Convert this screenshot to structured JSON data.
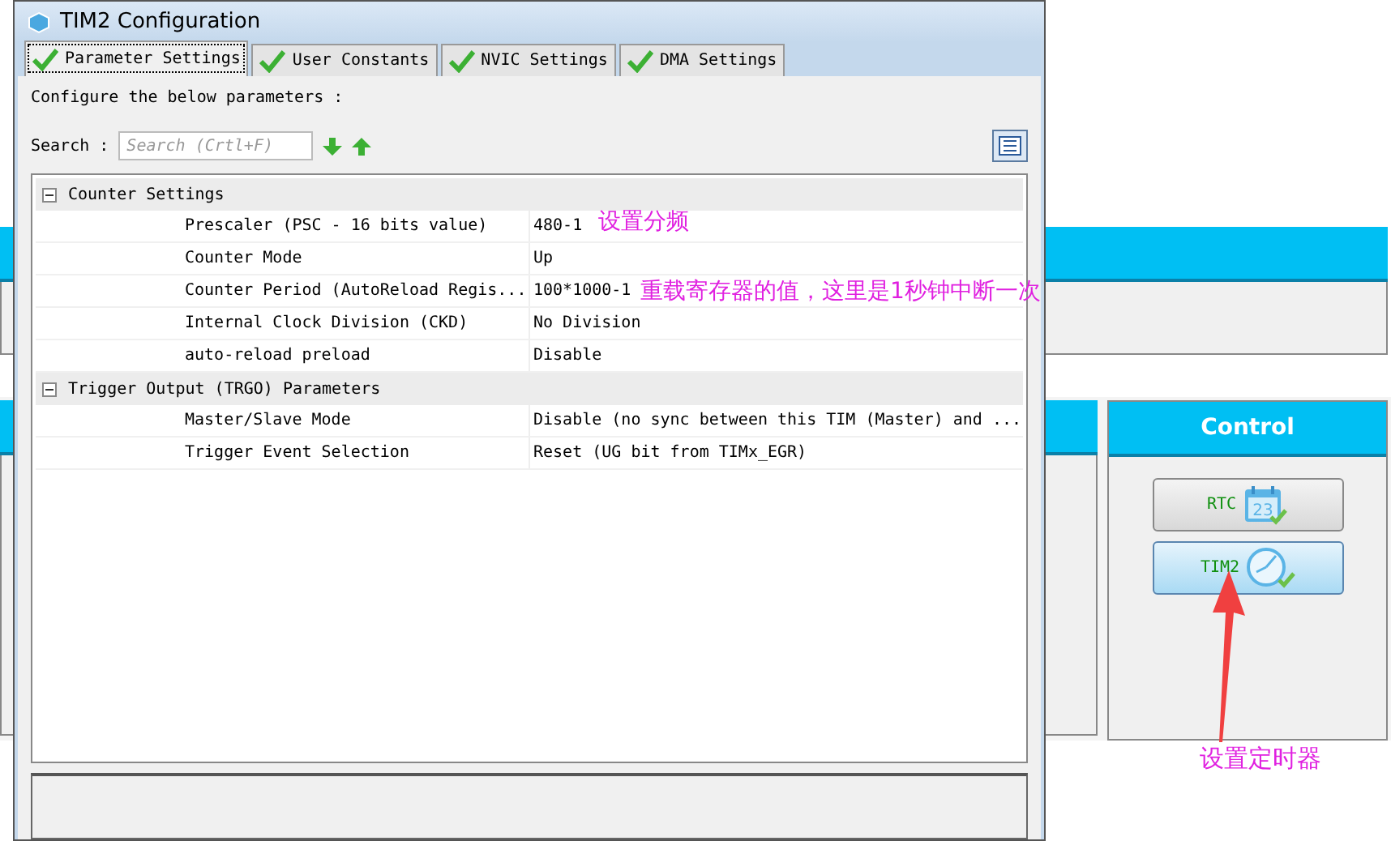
{
  "window": {
    "title": "TIM2 Configuration"
  },
  "tabs": [
    {
      "label": "Parameter Settings",
      "selected": true
    },
    {
      "label": "User Constants",
      "selected": false
    },
    {
      "label": "NVIC Settings",
      "selected": false
    },
    {
      "label": "DMA Settings",
      "selected": false
    }
  ],
  "intro": "Configure the below parameters :",
  "search": {
    "label": "Search :",
    "placeholder": "Search (Crtl+F)"
  },
  "groups": [
    {
      "title": "Counter Settings",
      "expanded": true,
      "params": [
        {
          "name": "Prescaler (PSC - 16 bits value)",
          "value": "480-1",
          "note": "设置分频"
        },
        {
          "name": "Counter Mode",
          "value": "Up"
        },
        {
          "name": "Counter Period (AutoReload Regis...",
          "value": "100*1000-1",
          "note": "重载寄存器的值，这里是1秒钟中断一次"
        },
        {
          "name": "Internal Clock Division (CKD)",
          "value": "No Division"
        },
        {
          "name": "auto-reload preload",
          "value": "Disable"
        }
      ]
    },
    {
      "title": "Trigger Output (TRGO) Parameters",
      "expanded": true,
      "params": [
        {
          "name": "Master/Slave Mode",
          "value": "Disable (no sync between this TIM (Master) and ..."
        },
        {
          "name": "Trigger Event Selection",
          "value": "Reset (UG bit from TIMx_EGR)"
        }
      ]
    }
  ],
  "control": {
    "title": "Control",
    "buttons": [
      {
        "label": "RTC",
        "kind": "calendar",
        "selected": false,
        "icon_text": "23"
      },
      {
        "label": "TIM2",
        "kind": "clock",
        "selected": true
      }
    ],
    "note": "设置定时器"
  }
}
